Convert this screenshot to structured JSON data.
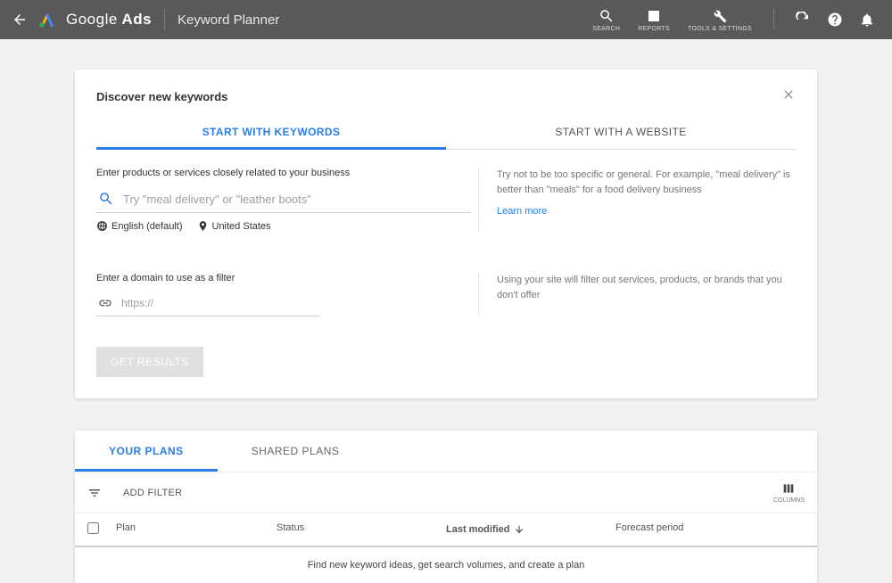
{
  "header": {
    "brand_g": "Google",
    "brand_a": " Ads",
    "section": "Keyword Planner",
    "tools": {
      "search": "SEARCH",
      "reports": "REPORTS",
      "settings": "TOOLS & SETTINGS"
    }
  },
  "discover": {
    "title": "Discover new keywords",
    "tabs": {
      "keywords": "START WITH KEYWORDS",
      "website": "START WITH A WEBSITE"
    },
    "products_label": "Enter products or services closely related to your business",
    "kw_placeholder": "Try \"meal delivery\" or \"leather boots\"",
    "lang": "English (default)",
    "loc": "United States",
    "tip": "Try not to be too specific or general. For example, \"meal delivery\" is better than \"meals\" for a food delivery business",
    "learn_more": "Learn more",
    "domain_label": "Enter a domain to use as a filter",
    "domain_placeholder": "https://",
    "domain_tip": "Using your site will filter out services, products, or brands that you don't offer",
    "get_results": "GET RESULTS"
  },
  "plans": {
    "tabs": {
      "your": "YOUR PLANS",
      "shared": "SHARED PLANS"
    },
    "add_filter": "ADD FILTER",
    "columns_label": "COLUMNS",
    "cols": {
      "plan": "Plan",
      "status": "Status",
      "modified": "Last modified",
      "forecast": "Forecast period"
    },
    "empty": "Find new keyword ideas, get search volumes, and create a plan"
  }
}
